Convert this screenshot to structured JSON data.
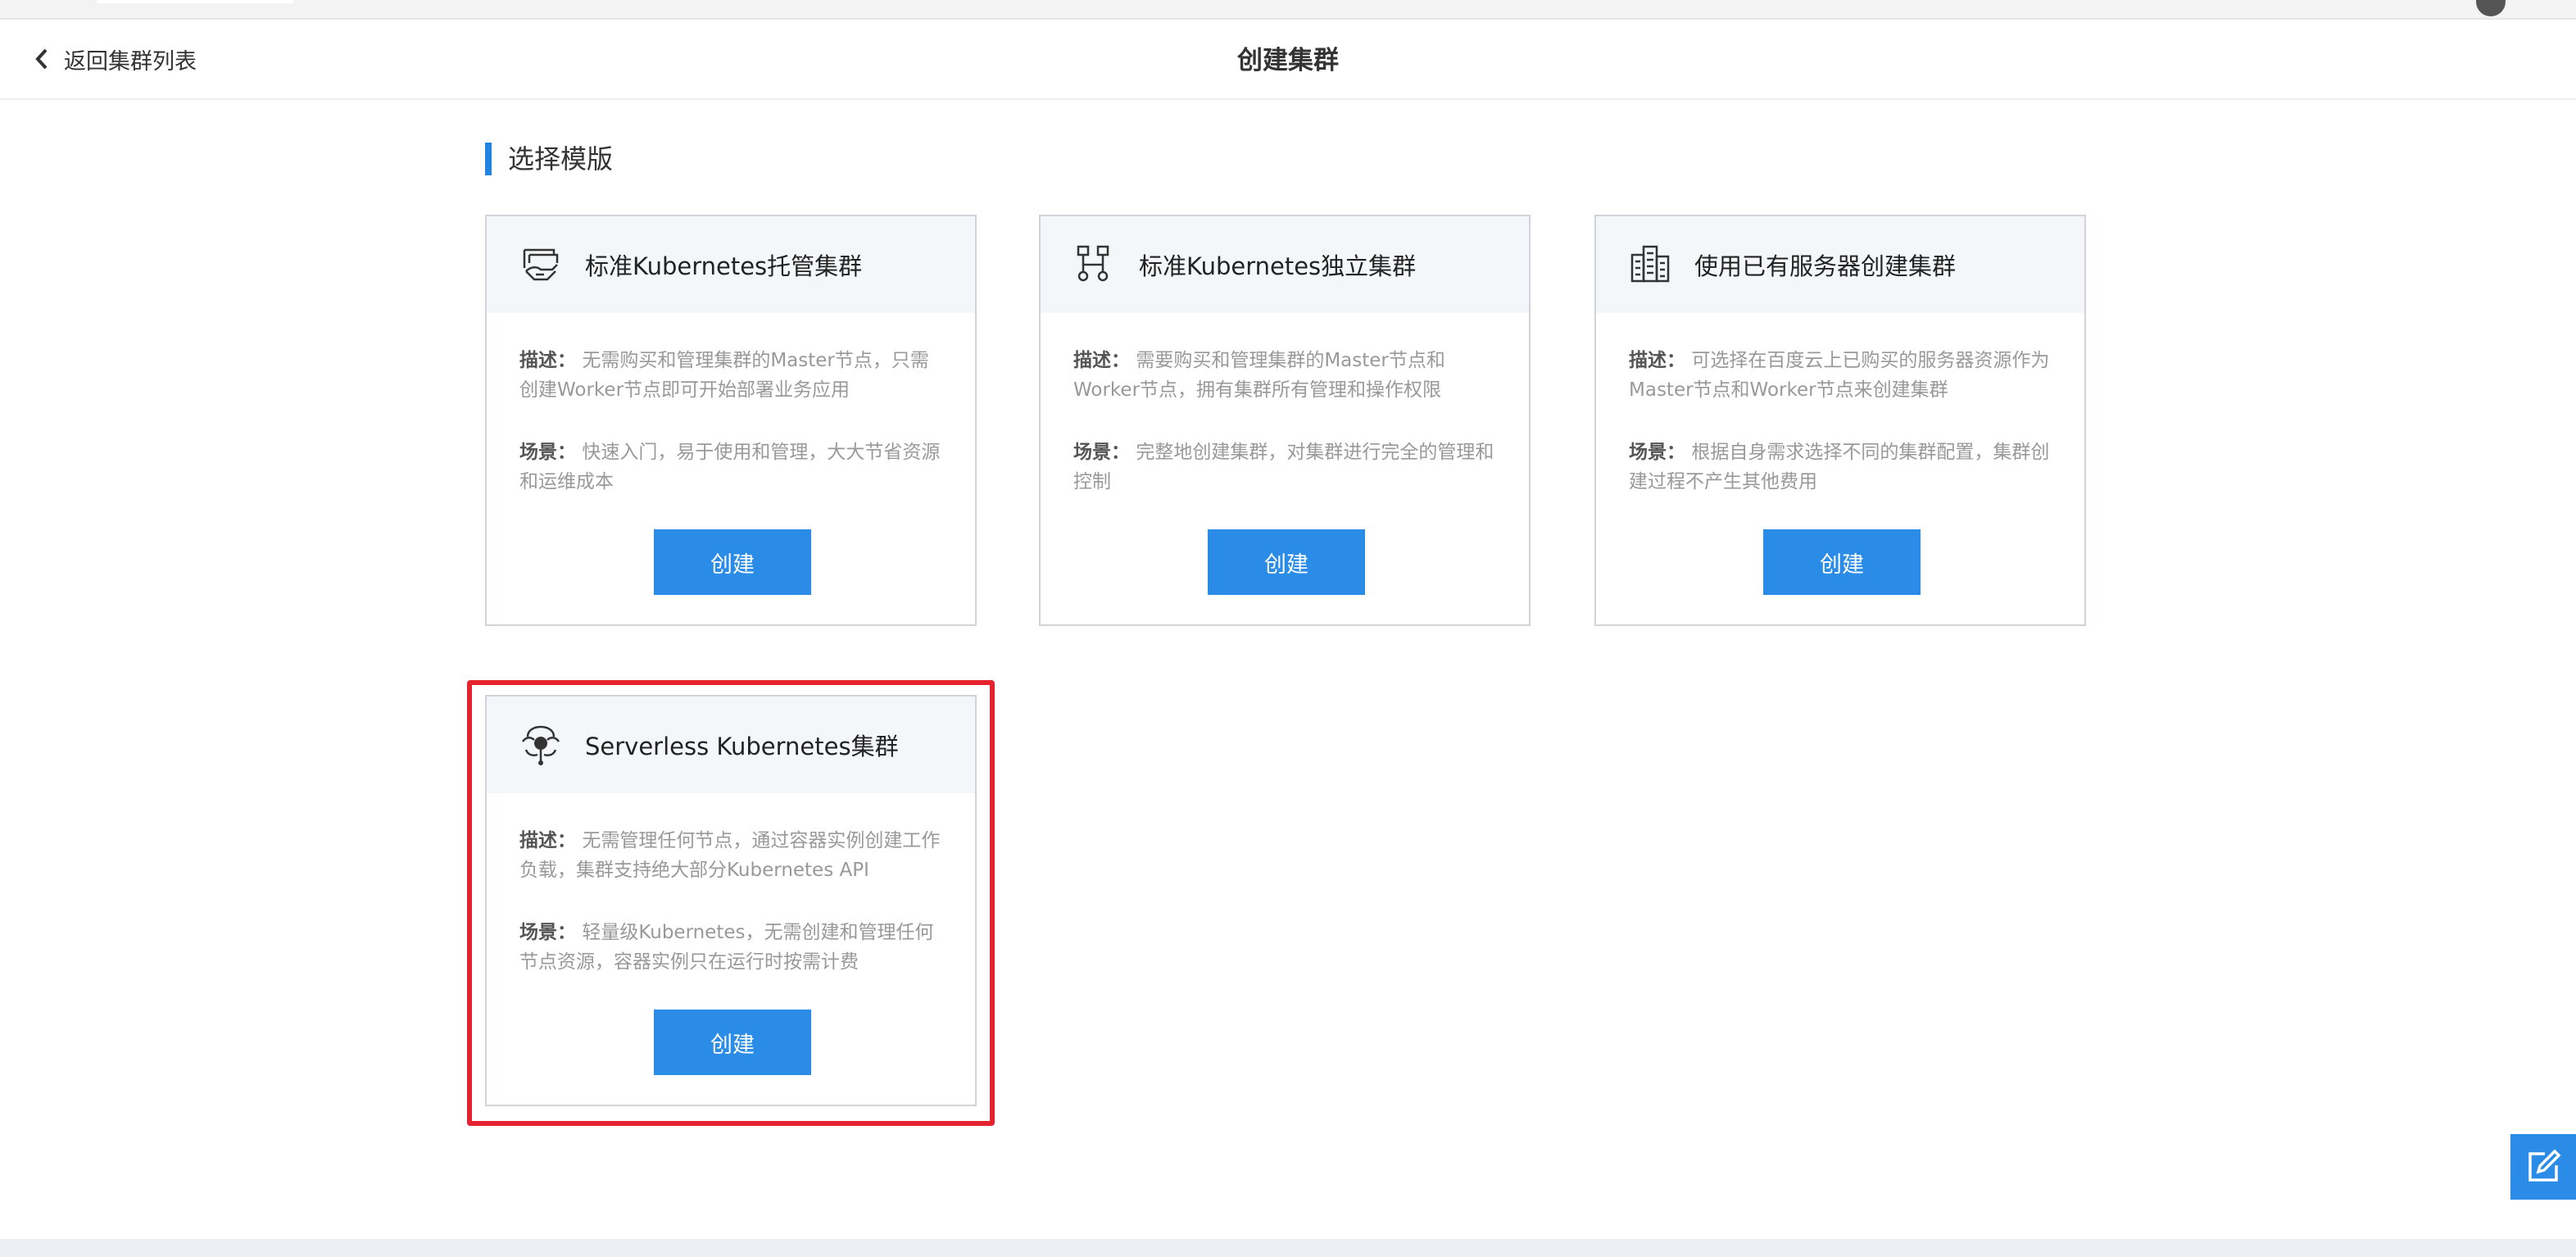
{
  "header": {
    "back_label": "返回集群列表",
    "title": "创建集群"
  },
  "section": {
    "title": "选择模版"
  },
  "cards": [
    {
      "icon": "hosted-cluster-icon",
      "title": "标准Kubernetes托管集群",
      "desc_label": "描述：",
      "desc": "无需购买和管理集群的Master节点，只需创建Worker节点即可开始部署业务应用",
      "scene_label": "场景：",
      "scene": "快速入门，易于使用和管理，大大节省资源和运维成本",
      "button": "创建"
    },
    {
      "icon": "standalone-cluster-icon",
      "title": "标准Kubernetes独立集群",
      "desc_label": "描述：",
      "desc": "需要购买和管理集群的Master节点和Worker节点，拥有集群所有管理和操作权限",
      "scene_label": "场景：",
      "scene": "完整地创建集群，对集群进行完全的管理和控制",
      "button": "创建"
    },
    {
      "icon": "server-building-icon",
      "title": "使用已有服务器创建集群",
      "desc_label": "描述：",
      "desc": "可选择在百度云上已购买的服务器资源作为Master节点和Worker节点来创建集群",
      "scene_label": "场景：",
      "scene": "根据自身需求选择不同的集群配置，集群创建过程不产生其他费用",
      "button": "创建"
    },
    {
      "icon": "serverless-icon",
      "title": "Serverless Kubernetes集群",
      "desc_label": "描述：",
      "desc": "无需管理任何节点，通过容器实例创建工作负载，集群支持绝大部分Kubernetes API",
      "scene_label": "场景：",
      "scene": "轻量级Kubernetes，无需创建和管理任何节点资源，容器实例只在运行时按需计费",
      "button": "创建"
    }
  ],
  "colors": {
    "accent": "#2a8ce6",
    "highlight": "#e5232f"
  },
  "float_button": {
    "icon": "edit-icon"
  }
}
